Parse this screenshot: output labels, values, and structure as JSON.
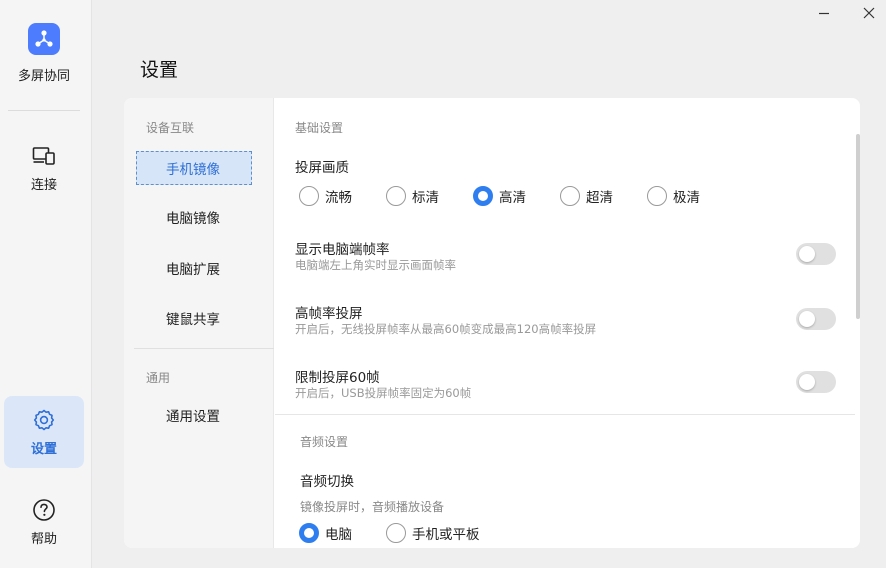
{
  "app": {
    "name": "多屏协同"
  },
  "nav": {
    "connect": "连接",
    "settings": "设置",
    "help": "帮助"
  },
  "page": {
    "title": "设置"
  },
  "subnav": {
    "group_device": "设备互联",
    "items": [
      "手机镜像",
      "电脑镜像",
      "电脑扩展",
      "键鼠共享"
    ],
    "group_general": "通用",
    "general_item": "通用设置",
    "active_index": 0
  },
  "basic": {
    "section": "基础设置",
    "quality": {
      "title": "投屏画质",
      "options": [
        "流畅",
        "标清",
        "高清",
        "超清",
        "极清"
      ],
      "selected": "高清"
    },
    "show_fps": {
      "title": "显示电脑端帧率",
      "desc": "电脑端左上角实时显示画面帧率",
      "on": false
    },
    "high_fps": {
      "title": "高帧率投屏",
      "desc": "开启后，无线投屏帧率从最高60帧变成最高120高帧率投屏",
      "on": false
    },
    "limit_60": {
      "title": "限制投屏60帧",
      "desc": "开启后，USB投屏帧率固定为60帧",
      "on": false
    }
  },
  "audio": {
    "section": "音频设置",
    "switch": {
      "title": "音频切换",
      "desc": "镜像投屏时，音频播放设备",
      "options": [
        "电脑",
        "手机或平板"
      ],
      "selected": "电脑"
    }
  },
  "colors": {
    "accent": "#2f7ef0",
    "active_bg": "#dbe7f8",
    "logo": "#4d7cfe"
  }
}
